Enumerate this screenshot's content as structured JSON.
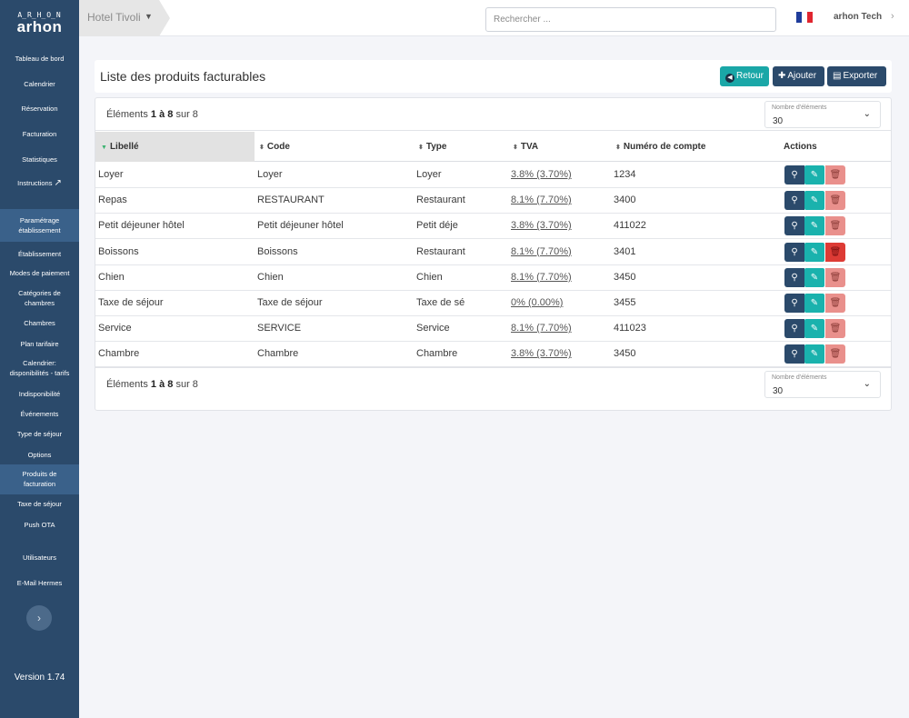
{
  "sidebar": {
    "logo_top": "A̲R̲H̲O̲N",
    "logo_text": "arhon",
    "items": [
      {
        "label": "Tableau de bord"
      },
      {
        "label": "Calendrier"
      },
      {
        "label": "Réservation"
      },
      {
        "label": "Facturation"
      },
      {
        "label": "Statistiques"
      },
      {
        "label": "Instructions"
      },
      {
        "label": "Paramétrage établissement"
      },
      {
        "label": "Établissement"
      },
      {
        "label": "Modes de paiement"
      },
      {
        "label": "Catégories de chambres"
      },
      {
        "label": "Chambres"
      },
      {
        "label": "Plan tarifaire"
      },
      {
        "label": "Calendrier: disponibilités - tarifs"
      },
      {
        "label": "Indisponibilité"
      },
      {
        "label": "Événements"
      },
      {
        "label": "Type de séjour"
      },
      {
        "label": "Options"
      },
      {
        "label": "Produits de facturation"
      },
      {
        "label": "Taxe de séjour"
      },
      {
        "label": "Push OTA"
      },
      {
        "label": "Utilisateurs"
      },
      {
        "label": "E-Mail Hermes"
      }
    ],
    "version": "Version 1.74"
  },
  "topbar": {
    "hotel": "Hotel Tivoli",
    "search_placeholder": "Rechercher ...",
    "user": "arhon Tech",
    "flag_colors": [
      "#1f3c9b",
      "#ffffff",
      "#e0252f"
    ]
  },
  "page": {
    "title": "Liste des produits facturables",
    "buttons": {
      "retour": "Retour",
      "ajouter": "Ajouter",
      "exporter": "Exporter"
    }
  },
  "pager": {
    "prefix": "Éléments ",
    "range": "1 à 8",
    "suffix": " sur 8",
    "size_label": "Nombre d'éléments",
    "size_value": "30"
  },
  "table": {
    "columns": [
      "Libellé",
      "Code",
      "Type",
      "TVA",
      "Numéro de compte",
      "Actions"
    ],
    "rows": [
      {
        "libelle": "Loyer",
        "code": "Loyer",
        "type": "Loyer",
        "tva": "3.8% (3.70%)",
        "compte": "1234"
      },
      {
        "libelle": "Repas",
        "code": "RESTAURANT",
        "type": "Restaurant",
        "tva": "8.1% (7.70%)",
        "compte": "3400"
      },
      {
        "libelle": "Petit déjeuner hôtel",
        "code": "Petit déjeuner hôtel",
        "type": "Petit déje",
        "tva": "3.8% (3.70%)",
        "compte": "411022"
      },
      {
        "libelle": "Boissons",
        "code": "Boissons",
        "type": "Restaurant",
        "tva": "8.1% (7.70%)",
        "compte": "3401"
      },
      {
        "libelle": "Chien",
        "code": "Chien",
        "type": "Chien",
        "tva": "8.1% (7.70%)",
        "compte": "3450"
      },
      {
        "libelle": "Taxe de séjour",
        "code": "Taxe de séjour",
        "type": "Taxe de sé",
        "tva": "0% (0.00%)",
        "compte": "3455"
      },
      {
        "libelle": "Service",
        "code": "SERVICE",
        "type": "Service",
        "tva": "8.1% (7.70%)",
        "compte": "411023"
      },
      {
        "libelle": "Chambre",
        "code": "Chambre",
        "type": "Chambre",
        "tva": "3.8% (3.70%)",
        "compte": "3450"
      }
    ]
  },
  "colors": {
    "sidebar": "#2b4a6b",
    "accent_teal": "#1aa7a7",
    "delete_light": "#e9908c",
    "delete_strong": "#dd3b35"
  }
}
